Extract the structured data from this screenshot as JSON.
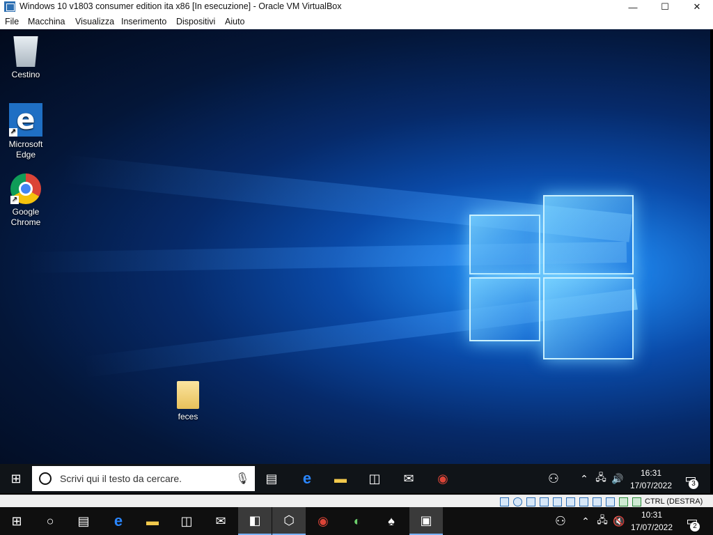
{
  "host_window": {
    "title": "Windows 10 v1803 consumer edition ita x86 [In esecuzione] - Oracle VM VirtualBox",
    "controls": {
      "minimize": "—",
      "maximize": "☐",
      "close": "✕"
    }
  },
  "menubar": {
    "items": [
      "File",
      "Macchina",
      "Visualizza",
      "Inserimento",
      "Dispositivi",
      "Aiuto"
    ]
  },
  "desktop": {
    "icons": [
      {
        "label": "Cestino",
        "icon": "recycle-bin-icon"
      },
      {
        "label": "Microsoft Edge",
        "icon": "edge-icon",
        "glyph": "e"
      },
      {
        "label": "Google Chrome",
        "icon": "chrome-icon"
      },
      {
        "label": "feces",
        "icon": "folder-icon"
      }
    ]
  },
  "guest_taskbar": {
    "search_placeholder": "Scrivi qui il testo da cercare.",
    "apps": [
      "task-view-icon",
      "edge-icon",
      "file-explorer-icon",
      "store-icon",
      "mail-icon",
      "chrome-icon"
    ],
    "clock": {
      "time": "16:31",
      "date": "17/07/2022"
    },
    "notification_count": "3"
  },
  "vbox_status": {
    "devices": [
      "hard-disk",
      "optical-drive",
      "audio",
      "network",
      "usb",
      "shared-folders",
      "display",
      "video-capture",
      "guest-additions",
      "mouse-integration"
    ],
    "host_key": "CTRL (DESTRA)"
  },
  "host_taskbar": {
    "apps": [
      "start-icon",
      "cortana-icon",
      "task-view-icon",
      "edge-icon",
      "file-explorer-icon",
      "store-icon",
      "mail-icon",
      "virtualbox-manager-icon",
      "virtualbox-icon",
      "chrome-icon",
      "network-app-icon",
      "solitaire-icon",
      "vm-window-icon"
    ],
    "clock": {
      "time": "10:31",
      "date": "17/07/2022"
    },
    "notification_count": "2"
  },
  "colors": {
    "accent": "#1f6fc4",
    "taskbar": "#101418",
    "host_taskbar": "#0f0f0f"
  }
}
